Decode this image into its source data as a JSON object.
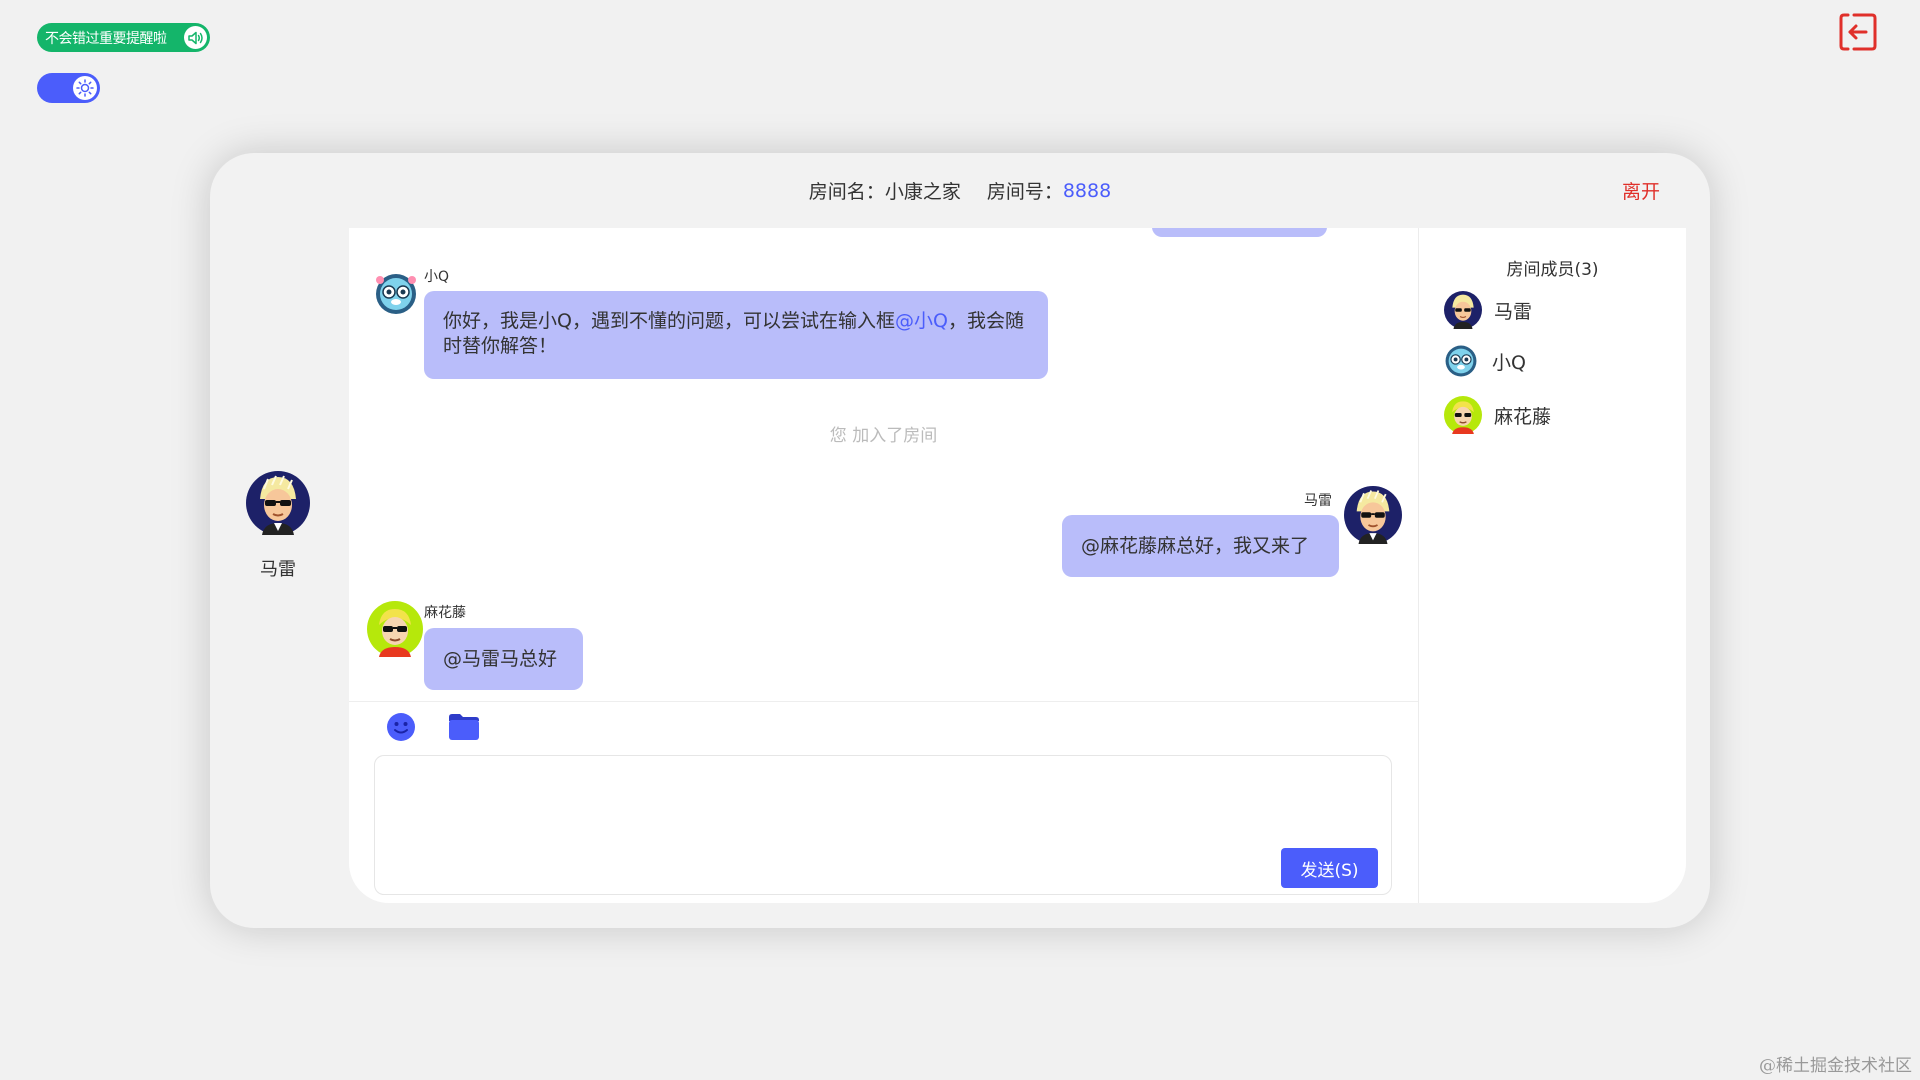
{
  "notify": {
    "label": "不会错过重要提醒啦",
    "icon": "speaker-icon"
  },
  "theme": {
    "icon": "sun-icon",
    "state": "on"
  },
  "room": {
    "name_label": "房间名：",
    "name": "小康之家",
    "number_label": "房间号：",
    "number": "8888",
    "leave_label": "离开"
  },
  "self_user": {
    "name": "马雷"
  },
  "messages": {
    "m1": {
      "sender": "小Q",
      "text_before": "你好，我是小Q，遇到不懂的问题，可以尝试在输入框",
      "mention": "@小Q",
      "text_after": "，我会随时替你解答！"
    },
    "system": "您 加入了房间",
    "m2": {
      "sender": "马雷",
      "text": "@麻花藤麻总好，我又来了"
    },
    "m3": {
      "sender": "麻花藤",
      "text": "@马雷马总好"
    }
  },
  "composer": {
    "send_label": "发送(S)",
    "emoji_icon": "smile-icon",
    "file_icon": "folder-icon"
  },
  "members": {
    "title": "房间成员(3)",
    "list": [
      {
        "name": "马雷"
      },
      {
        "name": "小Q"
      },
      {
        "name": "麻花藤"
      }
    ]
  },
  "watermark": "@稀土掘金技术社区",
  "colors": {
    "accent": "#4b5dfb",
    "bubble": "#b9bdfa",
    "notify_green": "#14b56a",
    "leave_red": "#e0302a"
  }
}
